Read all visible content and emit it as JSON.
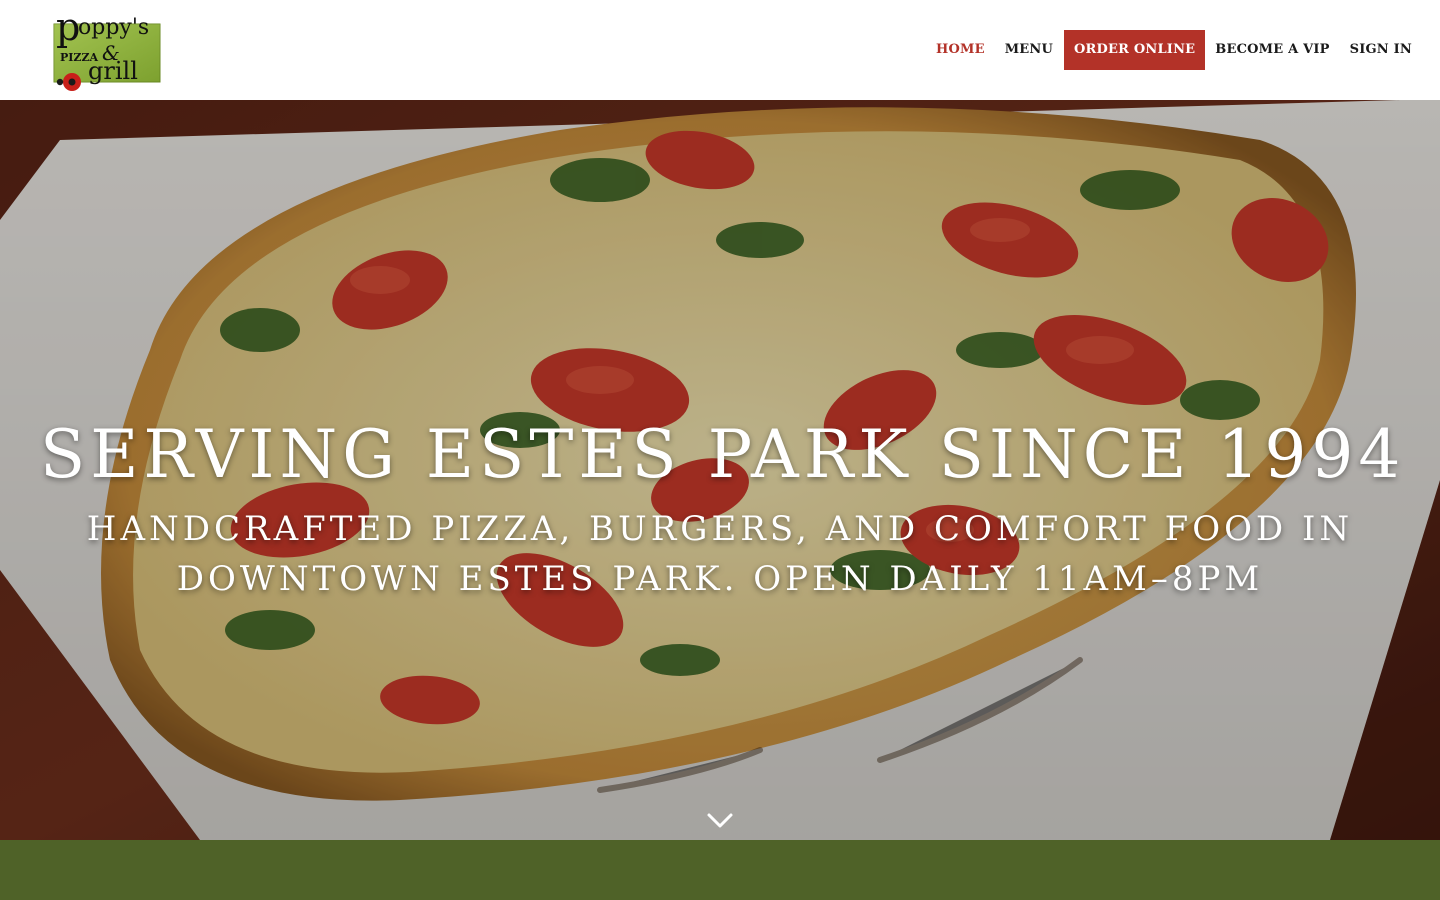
{
  "brand": {
    "logo_name": "Poppy's Pizza & Grill",
    "colors": {
      "accent": "#b33228",
      "logo_green": "#8db33a",
      "band_green": "#4f6228"
    }
  },
  "nav": {
    "items": [
      {
        "label": "HOME",
        "active": true
      },
      {
        "label": "MENU"
      },
      {
        "label": "ORDER ONLINE",
        "highlight": true
      },
      {
        "label": "BECOME A VIP"
      },
      {
        "label": "SIGN IN"
      }
    ]
  },
  "hero": {
    "title": "Serving Estes Park Since 1994",
    "subtitle": "Handcrafted pizza, burgers, and comfort food in downtown Estes Park. Open daily 11am–8pm",
    "scroll_icon": "chevron-down-icon"
  }
}
